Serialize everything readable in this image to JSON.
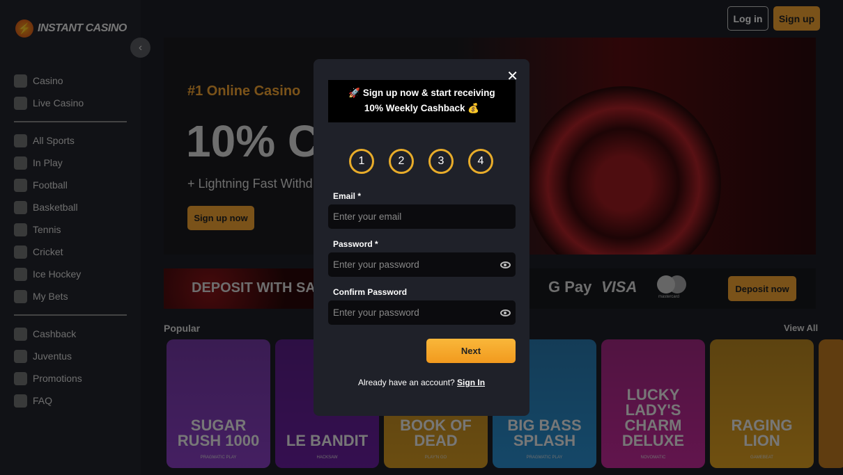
{
  "brand": {
    "name": "INSTANT CASINO"
  },
  "header": {
    "login": "Log in",
    "signup": "Sign up"
  },
  "sidebar": {
    "groups": [
      [
        {
          "label": "Casino",
          "icon": "slot-machine-icon"
        },
        {
          "label": "Live Casino",
          "icon": "card-icon"
        }
      ],
      [
        {
          "label": "All Sports",
          "icon": "sports-icon"
        },
        {
          "label": "In Play",
          "icon": "live-icon"
        },
        {
          "label": "Football",
          "icon": "football-icon"
        },
        {
          "label": "Basketball",
          "icon": "basketball-icon"
        },
        {
          "label": "Tennis",
          "icon": "tennis-icon"
        },
        {
          "label": "Cricket",
          "icon": "cricket-icon"
        },
        {
          "label": "Ice Hockey",
          "icon": "hockey-icon"
        },
        {
          "label": "My Bets",
          "icon": "bets-icon"
        }
      ],
      [
        {
          "label": "Cashback",
          "icon": "cashback-icon"
        },
        {
          "label": "Juventus",
          "icon": "juventus-icon"
        },
        {
          "label": "Promotions",
          "icon": "megaphone-icon"
        },
        {
          "label": "FAQ",
          "icon": "faq-icon"
        }
      ]
    ]
  },
  "hero": {
    "tag": "#1 Online Casino",
    "big": "10% CA",
    "sub": "+ Lightning Fast Withd",
    "button": "Sign up now"
  },
  "deposit": {
    "text": "DEPOSIT WITH SAF",
    "gpay": "G Pay",
    "visa": "VISA",
    "mastercard": "mastercard",
    "button": "Deposit now"
  },
  "popular": {
    "title": "Popular",
    "view_all": "View All",
    "games": [
      {
        "title": "SUGAR RUSH 1000",
        "provider": "PRAGMATIC PLAY",
        "color": "#8a3fc4"
      },
      {
        "title": "LE BANDIT",
        "provider": "HACKSAW",
        "color": "#6a1fa0"
      },
      {
        "title": "RICH WILDE AND THE BOOK OF DEAD",
        "provider": "PLAY'N GO",
        "color": "#d69a22"
      },
      {
        "title": "BIG BASS SPLASH",
        "provider": "PRAGMATIC PLAY",
        "color": "#2a8fd0"
      },
      {
        "title": "LUCKY LADY'S CHARM DELUXE",
        "provider": "NOVOMATIC",
        "color": "#c42a9a"
      },
      {
        "title": "RAGING LION",
        "provider": "GAMEBEAT",
        "color": "#e0a020"
      }
    ]
  },
  "modal": {
    "promo_line1": "🚀 Sign up now & start receiving",
    "promo_line2": "10% Weekly Cashback 💰",
    "steps": [
      "1",
      "2",
      "3",
      "4"
    ],
    "email_label": "Email *",
    "email_placeholder": "Enter your email",
    "password_label": "Password *",
    "password_placeholder": "Enter your password",
    "confirm_label": "Confirm Password",
    "confirm_placeholder": "Enter your password",
    "next": "Next",
    "already": "Already have an account?",
    "signin": "Sign In"
  },
  "colors": {
    "accent": "#f4a532",
    "step_ring": "#e8ac2a"
  }
}
